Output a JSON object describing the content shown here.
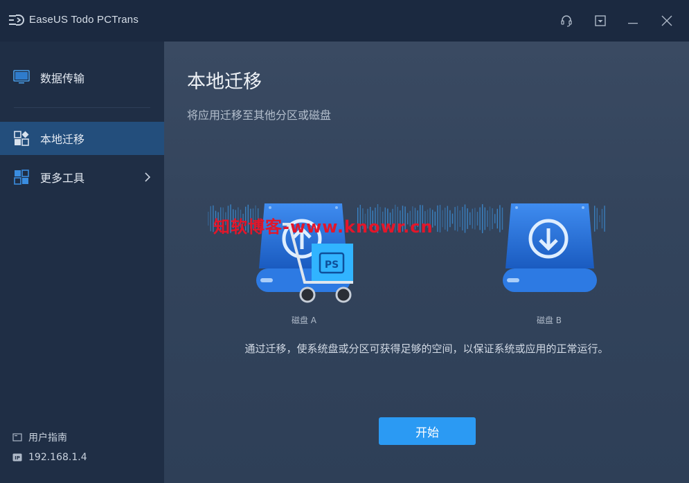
{
  "app": {
    "title": "EaseUS Todo PCTrans",
    "logo": "easeus-logo-icon"
  },
  "titlebar": {
    "buttons": [
      {
        "name": "support",
        "icon": "headset-icon"
      },
      {
        "name": "menu",
        "icon": "menu-dropdown-icon"
      },
      {
        "name": "minimize",
        "icon": "minimize-icon"
      },
      {
        "name": "close",
        "icon": "close-icon"
      }
    ]
  },
  "sidebar": {
    "items": [
      {
        "label": "数据传输",
        "icon": "monitor-icon",
        "active": false
      },
      {
        "label": "本地迁移",
        "icon": "grid-apps-icon",
        "active": true
      },
      {
        "label": "更多工具",
        "icon": "tools-grid-icon",
        "active": false,
        "has_submenu": true
      }
    ],
    "footer": {
      "guide_label": "用户指南",
      "ip_label": "192.168.1.4",
      "ip_badge": "IP"
    }
  },
  "main": {
    "title": "本地迁移",
    "subtitle": "将应用迁移至其他分区或磁盘",
    "disk_a_label": "磁盘 A",
    "disk_b_label": "磁盘 B",
    "cart_badge": "PS",
    "watermark": "知软博客-www.knowr.cn",
    "description": "通过迁移，使系统盘或分区可获得足够的空间，以保证系统或应用的正常运行。",
    "start_label": "开始"
  },
  "colors": {
    "titlebar_bg": "#1b2940",
    "sidebar_bg": "#1f2e45",
    "active_item_bg": "#234e7c",
    "accent": "#2b9af3",
    "disk_blue": "#1f6fd1",
    "watermark_red": "#e3162a"
  }
}
